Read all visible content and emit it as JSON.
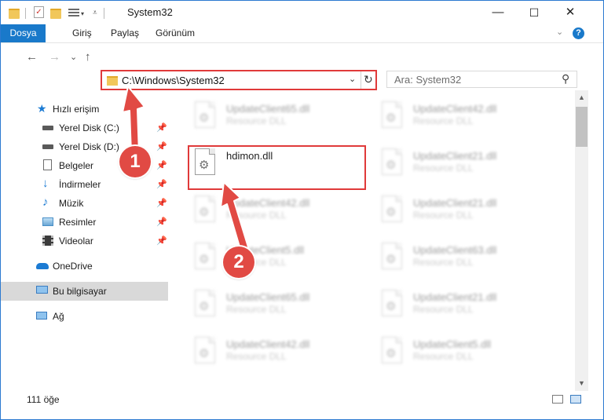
{
  "window": {
    "title": "System32",
    "minimize_glyph": "—",
    "maximize_glyph": "☐",
    "close_glyph": "✕"
  },
  "ribbon": {
    "file_tab": "Dosya",
    "tabs": [
      "Giriş",
      "Paylaş",
      "Görünüm"
    ],
    "help_glyph": "?",
    "collapse_glyph": "⌄"
  },
  "nav": {
    "back_glyph": "←",
    "forward_glyph": "→",
    "recent_glyph": "⌄",
    "up_glyph": "↑",
    "address": "C:\\Windows\\System32",
    "address_dropdown_glyph": "⌄",
    "refresh_glyph": "↻",
    "search_placeholder": "Ara: System32",
    "search_glyph": "⚲"
  },
  "sidebar": {
    "items": [
      {
        "label": "Hızlı erişim",
        "icon": "star-icon"
      },
      {
        "label": "Yerel Disk (C:)",
        "icon": "drive-icon",
        "pinned": true
      },
      {
        "label": "Yerel Disk (D:)",
        "icon": "drive-icon",
        "pinned": true
      },
      {
        "label": "Belgeler",
        "icon": "documents-icon",
        "pinned": true
      },
      {
        "label": "İndirmeler",
        "icon": "download-icon",
        "pinned": true
      },
      {
        "label": "Müzik",
        "icon": "music-icon",
        "pinned": true
      },
      {
        "label": "Resimler",
        "icon": "pictures-icon",
        "pinned": true
      },
      {
        "label": "Videolar",
        "icon": "video-icon",
        "pinned": true
      },
      {
        "label": "OneDrive",
        "icon": "cloud-icon"
      },
      {
        "label": "Bu bilgisayar",
        "icon": "computer-icon",
        "selected": true
      },
      {
        "label": "Ağ",
        "icon": "network-icon"
      }
    ],
    "pin_glyph": "📌"
  },
  "files": {
    "highlighted": {
      "name": "hdimon.dll"
    },
    "left_column": [
      {
        "name": "UpdateClient65.dll",
        "type": "Resource DLL"
      },
      {
        "name": "UpdateClient42.dll",
        "type": "Resource DLL"
      },
      {
        "name": "UpdateClient5.dll",
        "type": "Resource DLL"
      },
      {
        "name": "UpdateClient65.dll",
        "type": "Resource DLL"
      },
      {
        "name": "UpdateClient42.dll",
        "type": "Resource DLL"
      }
    ],
    "right_column": [
      {
        "name": "UpdateClient42.dll",
        "type": "Resource DLL"
      },
      {
        "name": "UpdateClient21.dll",
        "type": "Resource DLL"
      },
      {
        "name": "UpdateClient21.dll",
        "type": "Resource DLL"
      },
      {
        "name": "UpdateClient63.dll",
        "type": "Resource DLL"
      },
      {
        "name": "UpdateClient21.dll",
        "type": "Resource DLL"
      },
      {
        "name": "UpdateClient5.dll",
        "type": "Resource DLL"
      }
    ]
  },
  "status": {
    "item_count": "111 öğe"
  },
  "annotations": {
    "step1": "1",
    "step2": "2",
    "color": "#e14a44"
  }
}
